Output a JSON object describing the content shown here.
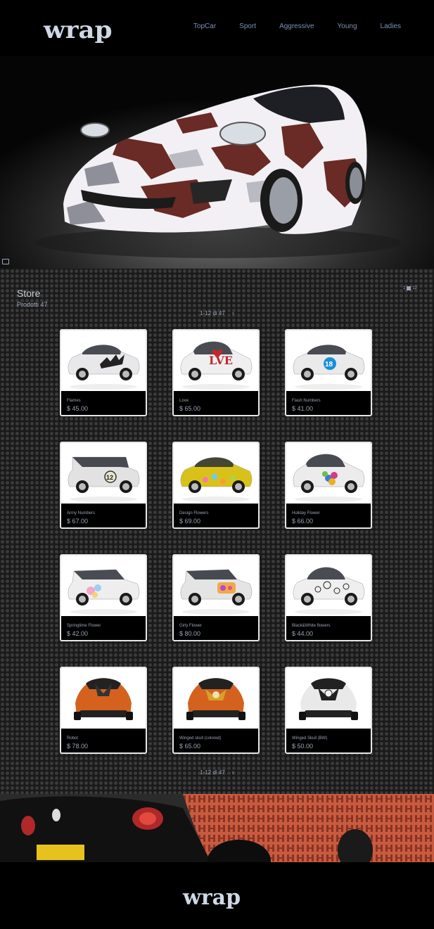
{
  "header": {
    "logo": "wrap",
    "nav": [
      "TopCar",
      "Sport",
      "Aggressive",
      "Young",
      "Ladies"
    ]
  },
  "store": {
    "title": "Store",
    "count_label": "Prodotti 47",
    "right_label": "1",
    "right_label2": "12",
    "pager_label": "1-12 di 47",
    "products": [
      {
        "name": "Flames",
        "price": "$ 45.00",
        "car": "sport",
        "body": "#e8e8ea",
        "decal": "flames"
      },
      {
        "name": "Love",
        "price": "$ 65.00",
        "car": "mini",
        "body": "#efefef",
        "decal": "love"
      },
      {
        "name": "Flash Numbers",
        "price": "$ 41.00",
        "car": "hatch",
        "body": "#eaeaea",
        "decal": "number18"
      },
      {
        "name": "Army Numbers",
        "price": "$ 67.00",
        "car": "jeep",
        "body": "#e2e2e2",
        "decal": "number12"
      },
      {
        "name": "Design Flowers",
        "price": "$ 69.00",
        "car": "hatch",
        "body": "#d8c21a",
        "decal": "flowers"
      },
      {
        "name": "Holiday Flower",
        "price": "$ 66.00",
        "car": "mini",
        "body": "#ececec",
        "decal": "holiday"
      },
      {
        "name": "Springtime Flower",
        "price": "$ 42.00",
        "car": "panda",
        "body": "#eeeeee",
        "decal": "spring"
      },
      {
        "name": "Girly Flower",
        "price": "$ 80.00",
        "car": "panda",
        "body": "#e4e4e4",
        "decal": "girly"
      },
      {
        "name": "Black&White flowers",
        "price": "$ 44.00",
        "car": "beetle",
        "body": "#efefef",
        "decal": "bw"
      },
      {
        "name": "Robot",
        "price": "$ 78.00",
        "car": "front",
        "body": "#d4621e",
        "decal": "robot"
      },
      {
        "name": "Winged skull (colored)",
        "price": "$ 65.00",
        "car": "front",
        "body": "#d4621e",
        "decal": "skullc"
      },
      {
        "name": "Winged Skull (BW)",
        "price": "$ 50.00",
        "car": "front",
        "body": "#e9e9e9",
        "decal": "skullbw"
      }
    ]
  },
  "footer": {
    "logo": "wrap"
  },
  "colors": {
    "nav": "#7d8fb7",
    "logo": "#cfd8e4",
    "camo_red": "#6a2a25",
    "camo_white": "#f2f0f4",
    "camo_grey": "#8e8f98"
  }
}
